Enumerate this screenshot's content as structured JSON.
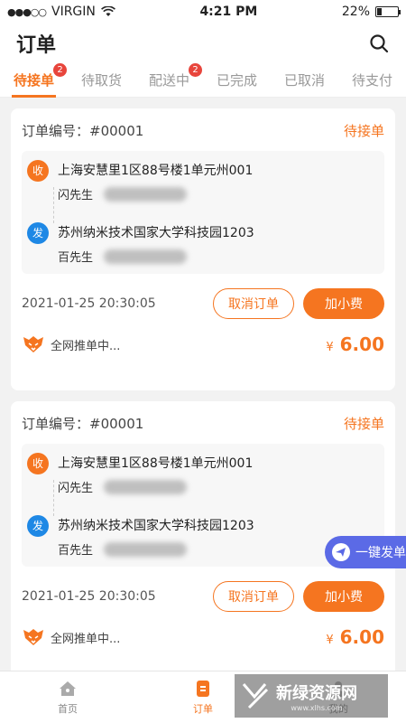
{
  "status_bar": {
    "carrier": "VIRGIN",
    "time": "4:21 PM",
    "battery": "22%",
    "battery_level": 0.22
  },
  "header": {
    "title": "订单"
  },
  "tabs": [
    {
      "label": "待接单",
      "badge": "2",
      "active": true
    },
    {
      "label": "待取货"
    },
    {
      "label": "配送中",
      "badge": "2"
    },
    {
      "label": "已完成"
    },
    {
      "label": "已取消"
    },
    {
      "label": "待支付"
    }
  ],
  "orders": [
    {
      "order_label": "订单编号：#00001",
      "status": "待接单",
      "receiver": {
        "tag": "收",
        "address": "上海安慧里1区88号楼1单元州001",
        "name": "闪先生"
      },
      "sender": {
        "tag": "发",
        "address": "苏州纳米技术国家大学科技园1203",
        "name": "百先生"
      },
      "time": "2021-01-25 20:30:05",
      "cancel_label": "取消订单",
      "tip_label": "加小费",
      "push_text": "全网推单中...",
      "price_symbol": "¥",
      "price": "6.00"
    },
    {
      "order_label": "订单编号：#00001",
      "status": "待接单",
      "receiver": {
        "tag": "收",
        "address": "上海安慧里1区88号楼1单元州001",
        "name": "闪先生"
      },
      "sender": {
        "tag": "发",
        "address": "苏州纳米技术国家大学科技园1203",
        "name": "百先生"
      },
      "time": "2021-01-25 20:30:05",
      "cancel_label": "取消订单",
      "tip_label": "加小费",
      "push_text": "全网推单中...",
      "price_symbol": "¥",
      "price": "6.00"
    }
  ],
  "float_button": {
    "label": "一键发单"
  },
  "tabbar": [
    {
      "label": "首页",
      "icon": "home-icon"
    },
    {
      "label": "订单",
      "icon": "order-icon",
      "active": true
    },
    {
      "label": "我的",
      "icon": "profile-icon"
    }
  ],
  "watermark": {
    "text": "新绿资源网",
    "sub": "www.xlhs.com"
  },
  "colors": {
    "accent": "#f57520",
    "sender": "#1e88e5",
    "float": "#5b6ae6",
    "badge": "#e8453c"
  }
}
